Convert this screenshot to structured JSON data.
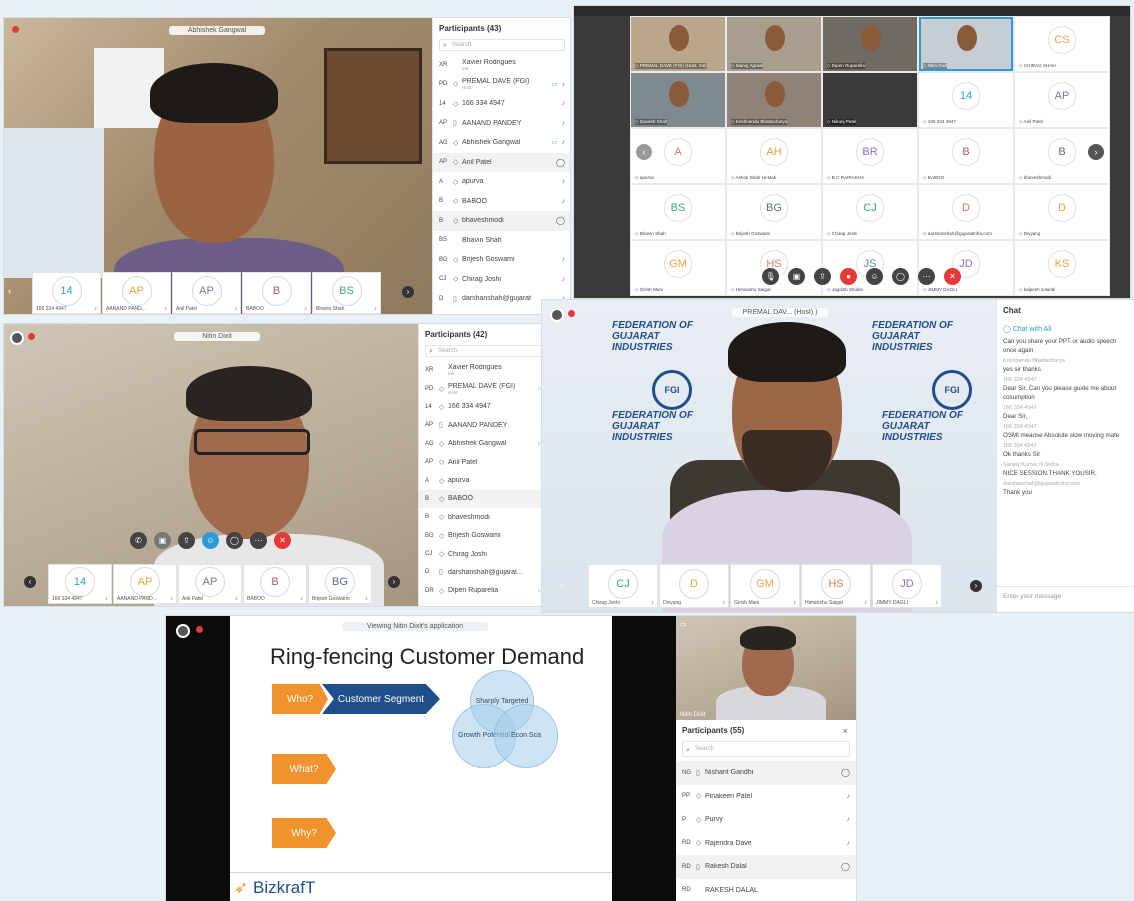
{
  "panel1": {
    "speaker_name": "Abhishek Gangwal",
    "participants_title": "Participants (43)",
    "search_placeholder": "Search",
    "participants": [
      {
        "initials": "XR",
        "name": "Xavier Rodrigues",
        "sub": "me",
        "device": ""
      },
      {
        "initials": "PD",
        "name": "PREMAL DAVE (FGI)",
        "sub": "Host",
        "device": "◇",
        "cam": true
      },
      {
        "initials": "14",
        "name": "166 334 4947",
        "device": "◇"
      },
      {
        "initials": "AP",
        "name": "AANAND PANDEY",
        "device": "▯"
      },
      {
        "initials": "AG",
        "name": "Abhishek Gangwal",
        "device": "◇",
        "cam": true
      },
      {
        "initials": "AP",
        "name": "Anil Patel",
        "device": "◇",
        "chat": true
      },
      {
        "initials": "A",
        "name": "apurva",
        "device": "◇"
      },
      {
        "initials": "B",
        "name": "BABOO",
        "device": "◇"
      },
      {
        "initials": "B",
        "name": "bhaveshmodi",
        "device": "◇",
        "chat": true
      },
      {
        "initials": "BS",
        "name": "Bhavin Shah",
        "device": ""
      },
      {
        "initials": "BG",
        "name": "Brijesh Goswami",
        "device": "◇"
      },
      {
        "initials": "CJ",
        "name": "Chirag Joshi",
        "device": "◇"
      },
      {
        "initials": "D",
        "name": "darshanshah@gujarat",
        "device": "▯"
      }
    ],
    "thumbs": [
      {
        "initials": "14",
        "label": "166 334 4947",
        "color": "#2e9bd6"
      },
      {
        "initials": "AP",
        "label": "AANAND PAND...",
        "color": "#f0a040"
      },
      {
        "initials": "AP",
        "label": "Anil Patel",
        "color": "#8a6fb0"
      },
      {
        "initials": "B",
        "label": "BABOO",
        "color": "#b05a7a"
      },
      {
        "initials": "BS",
        "label": "Bhavin Shah",
        "color": "#3aa883"
      }
    ]
  },
  "panel2": {
    "video_tiles": [
      {
        "label": "PREMAL DAVE (FGI) (Host, me)"
      },
      {
        "label": "Manoj Agrawl"
      },
      {
        "label": "Dipen Ruparelia"
      },
      {
        "label": "Nitin Dixit"
      },
      {
        "label": "CHIRAG SHAH",
        "initials": "CS",
        "color": "#f0a040"
      },
      {
        "label": "Daxesh Shah"
      },
      {
        "label": "Krishnendu Bhattacharya"
      },
      {
        "label": "Nikunj Patel"
      },
      {
        "label": "166 334 4947",
        "initials": "14",
        "color": "#2e9bd6"
      },
      {
        "label": "Anil Patel",
        "initials": "AP",
        "color": "#8a6fb0"
      },
      {
        "label": "apurva",
        "initials": "A",
        "color": "#e07a5f"
      },
      {
        "label": "Ashok Shah Hi-Mak",
        "initials": "AH",
        "color": "#f0a040"
      },
      {
        "label": "B C RAIRAKHA",
        "initials": "BR",
        "color": "#8a6fb0"
      },
      {
        "label": "BABOO",
        "initials": "B",
        "color": "#b05a7a"
      },
      {
        "label": "bhaveshmodi",
        "initials": "B",
        "color": "#5a6f8a"
      },
      {
        "label": "Bhavin Shah",
        "initials": "BS",
        "color": "#3aa883"
      },
      {
        "label": "Brijesh Goswami",
        "initials": "BG",
        "color": "#5a6f8a"
      },
      {
        "label": "Chirag Joshi",
        "initials": "CJ",
        "color": "#3aa883"
      },
      {
        "label": "darshanshah@gujaratinfra.com",
        "initials": "D",
        "color": "#e07a5f"
      },
      {
        "label": "Divyang",
        "initials": "D",
        "color": "#f0a040"
      },
      {
        "label": "Girish Mani",
        "initials": "GM",
        "color": "#f0a040"
      },
      {
        "label": "Himanshu Saigal",
        "initials": "HS",
        "color": "#e07a5f"
      },
      {
        "label": "Jagdish Shukla",
        "initials": "JS",
        "color": "#5a8ab0"
      },
      {
        "label": "JIMMY DAGLI",
        "initials": "JD",
        "color": "#8a6fb0"
      },
      {
        "label": "kalpesh solanki",
        "initials": "KS",
        "color": "#f0a040"
      }
    ]
  },
  "panel3": {
    "speaker_name": "Nitin Dixit",
    "participants_title": "Participants (42)",
    "search_placeholder": "Search",
    "participants": [
      {
        "initials": "XR",
        "name": "Xavier Rodrigues",
        "sub": "me",
        "device": ""
      },
      {
        "initials": "PD",
        "name": "PREMAL DAVE (FGI)",
        "sub": "Host",
        "device": "◇",
        "cam": true
      },
      {
        "initials": "14",
        "name": "166 334 4947",
        "device": "◇"
      },
      {
        "initials": "AP",
        "name": "AANAND PANDEY",
        "device": "▯"
      },
      {
        "initials": "AG",
        "name": "Abhishek Gangwal",
        "device": "◇",
        "cam": true
      },
      {
        "initials": "AP",
        "name": "Anil Patel",
        "device": "◇"
      },
      {
        "initials": "A",
        "name": "apurva",
        "device": "◇"
      },
      {
        "initials": "B",
        "name": "BABOO",
        "device": "◇",
        "chat": true
      },
      {
        "initials": "B",
        "name": "bhaveshmodi",
        "device": "◇"
      },
      {
        "initials": "BG",
        "name": "Brijesh Goswami",
        "device": "◇"
      },
      {
        "initials": "CJ",
        "name": "Chirag Joshi",
        "device": "◇"
      },
      {
        "initials": "D",
        "name": "darshanshah@gujarat...",
        "device": "▯"
      },
      {
        "initials": "DR",
        "name": "Dipen Ruparelia",
        "device": "◇",
        "cam": true
      }
    ],
    "thumbs": [
      {
        "initials": "14",
        "label": "166 334 4947",
        "color": "#2e9bd6"
      },
      {
        "initials": "AP",
        "label": "AANAND PAND...",
        "color": "#f0a040"
      },
      {
        "initials": "AP",
        "label": "Anil Patel",
        "color": "#8a6fb0"
      },
      {
        "initials": "B",
        "label": "BABOO",
        "color": "#b05a7a"
      },
      {
        "initials": "BG",
        "label": "Brijesh Goswami",
        "color": "#5a6f8a"
      }
    ]
  },
  "panel4": {
    "speaker_name": "PREMAL DAV...  (Host) )",
    "chat_title": "Chat",
    "chat_with": "Chat with All",
    "messages": [
      {
        "sender": "",
        "text": "Can you share your PPT or audio speech once again"
      },
      {
        "sender": "Krishnendu Bhattacharya",
        "text": "yes sir thanks"
      },
      {
        "sender": "166 334 4947",
        "text": "Dear Sir, Can you please guide me about cosumption"
      },
      {
        "sender": "166 334 4947",
        "text": "Dear Sir,"
      },
      {
        "sender": "166 334 4947",
        "text": "OSMI meanse Absolute slow moving mate"
      },
      {
        "sender": "166 334 4947",
        "text": "Ok thanks Sir"
      },
      {
        "sender": "Sanjay Kumar N Sinha",
        "text": "NICE SESSION,THANK YOUSIR,"
      },
      {
        "sender": "darshanshah@gujaratinfra.com",
        "text": "Thank you"
      }
    ],
    "input_placeholder": "Enter your message",
    "thumbs": [
      {
        "initials": "CJ",
        "label": "Chirag Joshi",
        "color": "#3aa883"
      },
      {
        "initials": "D",
        "label": "Divyang",
        "color": "#f0a040"
      },
      {
        "initials": "GM",
        "label": "Girish Mani",
        "color": "#f0a040"
      },
      {
        "initials": "HS",
        "label": "Himanshu Saigal",
        "color": "#e07a5f"
      },
      {
        "initials": "JD",
        "label": "JIMMY DAGLI",
        "color": "#8a6fb0"
      }
    ],
    "banner_text": "FEDERATION OF GUJARAT INDUSTRIES",
    "logo_text": "FGI"
  },
  "panel5": {
    "viewing_label": "Viewing Nitin Dixit's application",
    "slide_title": "Ring-fencing Customer Demand",
    "chevrons": [
      "Who?",
      "Customer Segment",
      "What?",
      "Why?"
    ],
    "venn": [
      "Sharply Targeted",
      "Growth Potential",
      "Econ Sca"
    ],
    "brand": "BizkrafT",
    "speaker_name": "Nitin Dixit",
    "participants_title": "Participants (55)",
    "search_placeholder": "Search",
    "participants": [
      {
        "initials": "NG",
        "name": "Nishant Gandhi",
        "device": "▯",
        "chat": true,
        "hl": true
      },
      {
        "initials": "PP",
        "name": "Pinakeen Patel",
        "device": "◇"
      },
      {
        "initials": "P",
        "name": "Purvy",
        "device": "◇"
      },
      {
        "initials": "RD",
        "name": "Rajendra Dave",
        "device": "◇"
      },
      {
        "initials": "RD",
        "name": "Rakesh Dalal",
        "device": "▯",
        "chat": true,
        "hl": true
      },
      {
        "initials": "RD",
        "name": "RAKESH DALAL",
        "device": ""
      }
    ]
  }
}
